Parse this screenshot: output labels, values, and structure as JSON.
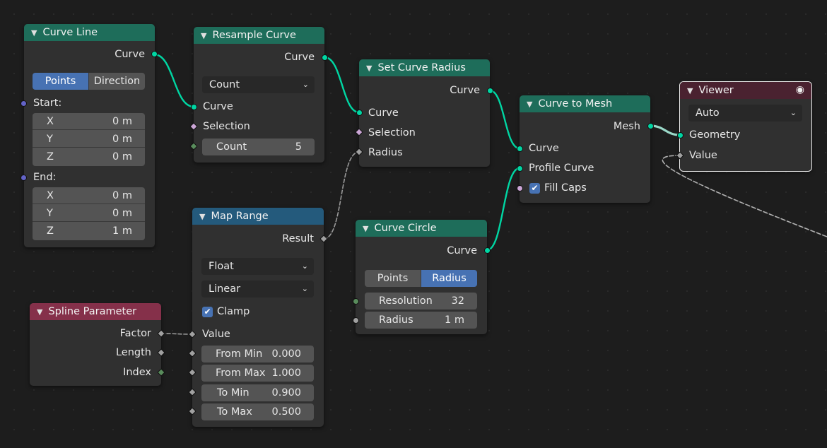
{
  "nodes": {
    "curve_line": {
      "title": "Curve Line",
      "output_curve": "Curve",
      "mode_points": "Points",
      "mode_direction": "Direction",
      "start_label": "Start:",
      "end_label": "End:",
      "start": [
        {
          "axis": "X",
          "value": "0 m"
        },
        {
          "axis": "Y",
          "value": "0 m"
        },
        {
          "axis": "Z",
          "value": "0 m"
        }
      ],
      "end": [
        {
          "axis": "X",
          "value": "0 m"
        },
        {
          "axis": "Y",
          "value": "0 m"
        },
        {
          "axis": "Z",
          "value": "1 m"
        }
      ]
    },
    "resample_curve": {
      "title": "Resample Curve",
      "output_curve": "Curve",
      "mode": "Count",
      "input_curve": "Curve",
      "input_selection": "Selection",
      "count_label": "Count",
      "count_value": "5"
    },
    "set_curve_radius": {
      "title": "Set Curve Radius",
      "output_curve": "Curve",
      "input_curve": "Curve",
      "input_selection": "Selection",
      "input_radius": "Radius"
    },
    "curve_to_mesh": {
      "title": "Curve to Mesh",
      "output_mesh": "Mesh",
      "input_curve": "Curve",
      "input_profile": "Profile Curve",
      "fill_caps": "Fill Caps"
    },
    "viewer": {
      "title": "Viewer",
      "domain": "Auto",
      "input_geometry": "Geometry",
      "input_value": "Value"
    },
    "map_range": {
      "title": "Map Range",
      "output_result": "Result",
      "data_type": "Float",
      "interpolation": "Linear",
      "clamp": "Clamp",
      "input_value": "Value",
      "fields": [
        {
          "label": "From Min",
          "value": "0.000"
        },
        {
          "label": "From Max",
          "value": "1.000"
        },
        {
          "label": "To Min",
          "value": "0.900"
        },
        {
          "label": "To Max",
          "value": "0.500"
        }
      ]
    },
    "curve_circle": {
      "title": "Curve Circle",
      "output_curve": "Curve",
      "mode_points": "Points",
      "mode_radius": "Radius",
      "resolution_label": "Resolution",
      "resolution_value": "32",
      "radius_label": "Radius",
      "radius_value": "1 m"
    },
    "spline_parameter": {
      "title": "Spline Parameter",
      "output_factor": "Factor",
      "output_length": "Length",
      "output_index": "Index"
    }
  },
  "icons": {
    "collapse": "chevron-down-icon",
    "dropdown": "dropdown-arrow-icon",
    "viewer_toggle": "eye-icon",
    "checkbox": "checkmark-icon"
  },
  "colors": {
    "geometry_socket": "#00d6a3",
    "vector_socket": "#6363c7",
    "boolean_socket": "#cca6d6",
    "integer_socket": "#598c5c",
    "float_socket": "#a1a1a1",
    "geometry_header": "#1e6d5a",
    "converter_header": "#245a7c",
    "input_header": "#85304a",
    "output_header": "#4a2230",
    "active_button": "#4772b3"
  }
}
